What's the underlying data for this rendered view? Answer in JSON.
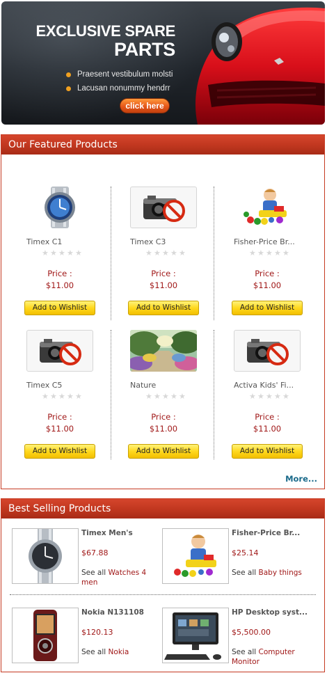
{
  "banner": {
    "title_line1": "EXCLUSIVE SPARE",
    "title_line2": "PARTS",
    "bullets": [
      "Praesent vestibulum molsti",
      "Lacusan nonummy hendrr"
    ],
    "cta": "click here",
    "accent": "#f0a020"
  },
  "featured": {
    "heading": "Our Featured Products",
    "more": "More...",
    "products": [
      {
        "name": "Timex C1",
        "price_label": "Price :",
        "price": "$11.00",
        "button": "Add to Wishlist",
        "image": "watch-icon"
      },
      {
        "name": "Timex C3",
        "price_label": "Price :",
        "price": "$11.00",
        "button": "Add to Wishlist",
        "image": "no-image-camera-icon"
      },
      {
        "name": "Fisher-Price Br...",
        "price_label": "Price :",
        "price": "$11.00",
        "button": "Add to Wishlist",
        "image": "toy-photo"
      },
      {
        "name": "Timex C5",
        "price_label": "Price :",
        "price": "$11.00",
        "button": "Add to Wishlist",
        "image": "no-image-camera-icon"
      },
      {
        "name": "Nature",
        "price_label": "Price :",
        "price": "$11.00",
        "button": "Add to Wishlist",
        "image": "garden-painting"
      },
      {
        "name": "Activa Kids' Fi...",
        "price_label": "Price :",
        "price": "$11.00",
        "button": "Add to Wishlist",
        "image": "no-image-camera-icon"
      }
    ]
  },
  "bestselling": {
    "heading": "Best Selling Products",
    "products": [
      {
        "name": "Timex Men's",
        "price": "$67.88",
        "see_all": "See all",
        "category": "Watches 4 men",
        "image": "wristwatch-photo"
      },
      {
        "name": "Fisher-Price Br...",
        "price": "$25.14",
        "see_all": "See all",
        "category": "Baby things",
        "image": "toy-photo"
      },
      {
        "name": "Nokia N131108",
        "price": "$120.13",
        "see_all": "See all",
        "category": "Nokia",
        "image": "phone-photo"
      },
      {
        "name": "HP Desktop syst...",
        "price": "$5,500.00",
        "see_all": "See all",
        "category": "Computer Monitor",
        "image": "desktop-photo"
      }
    ]
  },
  "colors": {
    "header_red": "#c23820",
    "price_red": "#a01818",
    "wishlist_yellow": "#ffd81e",
    "more_link": "#1a6a8a"
  }
}
